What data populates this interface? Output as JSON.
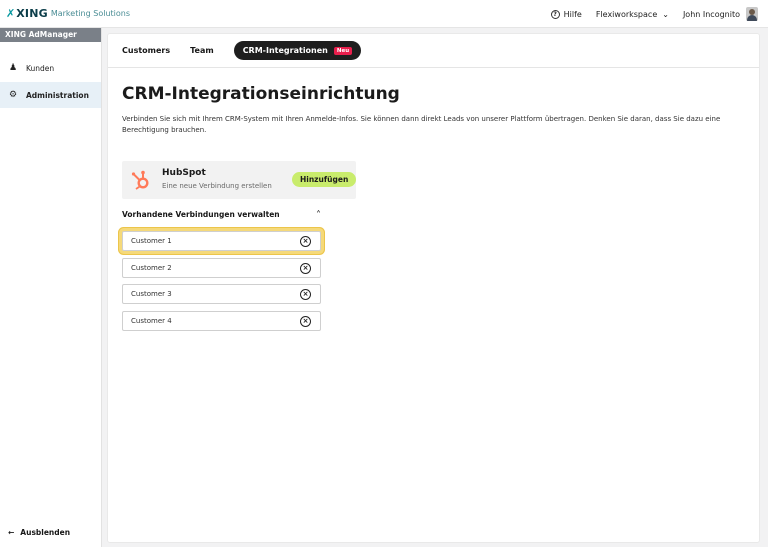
{
  "brand": {
    "name": "XING",
    "subtitle": "Marketing Solutions"
  },
  "topnav": {
    "help": "Hilfe",
    "workspace": "Flexiworkspace",
    "user": "John Incognito"
  },
  "sidebar": {
    "title": "XING AdManager",
    "items": [
      {
        "label": "Kunden",
        "icon": "people-icon"
      },
      {
        "label": "Administration",
        "icon": "gear-icon",
        "active": true
      }
    ],
    "collapse": "Ausblenden"
  },
  "tabs": [
    {
      "label": "Customers"
    },
    {
      "label": "Team"
    },
    {
      "label": "CRM-Integrationen",
      "badge": "Neu",
      "active": true
    }
  ],
  "page": {
    "title": "CRM-Integrationseinrichtung",
    "description": "Verbinden Sie sich mit Ihrem CRM-System mit Ihren Anmelde-Infos. Sie können dann direkt Leads von unserer Plattform übertragen. Denken Sie daran, dass Sie dazu eine Berechtigung brauchen."
  },
  "hubspot": {
    "name": "HubSpot",
    "subtitle": "Eine neue Verbindung erstellen",
    "button": "Hinzufügen",
    "brand_color": "#ff7a59",
    "button_color": "#c9ec6c"
  },
  "connections": {
    "header": "Vorhandene Verbindungen verwalten",
    "items": [
      "Customer 1",
      "Customer 2",
      "Customer 3",
      "Customer 4"
    ],
    "highlighted": "Customer 1",
    "highlight_color": "#f5d97a"
  }
}
